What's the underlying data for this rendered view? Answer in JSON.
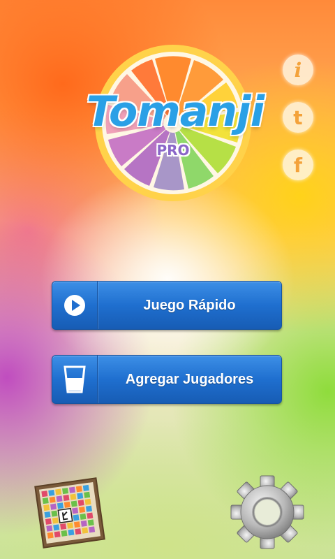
{
  "app": {
    "logo_title": "Tomanji",
    "logo_subtitle": "PRO"
  },
  "social": {
    "info_icon": "info-icon",
    "info_glyph": "i",
    "twitter_icon": "twitter-icon",
    "twitter_glyph": "t",
    "facebook_icon": "facebook-icon",
    "facebook_glyph": "f"
  },
  "menu": {
    "quick_game_label": "Juego Rápido",
    "add_players_label": "Agregar Jugadores"
  },
  "bottom": {
    "board_icon": "game-board-icon",
    "settings_icon": "settings-gear-icon"
  },
  "colors": {
    "button_blue": "#1f6fcf",
    "logo_blue": "#2aa0e6",
    "logo_purple": "#8a66c8",
    "social_orange": "#f4a23a"
  }
}
